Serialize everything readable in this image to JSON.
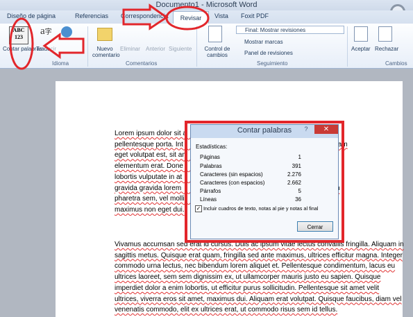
{
  "window": {
    "title": "Documento1 - Microsoft Word"
  },
  "tabs": [
    "Diseño de página",
    "Referencias",
    "Correspondencia",
    "Revisar",
    "Vista",
    "Foxit PDF"
  ],
  "ribbon": {
    "contar_palabras": "Contar palabras",
    "abc_icon_text": "ABC\n123",
    "traducir": "Traducir",
    "idioma": "Idioma",
    "nuevo_comentario": "Nuevo comentario",
    "eliminar": "Eliminar",
    "anterior": "Anterior",
    "siguiente": "Siguiente",
    "control_cambios": "Control de cambios",
    "final_mostrar": "Final: Mostrar revisiones",
    "mostrar_marcas": "Mostrar marcas",
    "panel_revisiones": "Panel de revisiones",
    "aceptar": "Aceptar",
    "rechazar": "Rechazar",
    "groups": {
      "idioma": "Idioma",
      "comentarios": "Comentarios",
      "seguimiento": "Seguimiento",
      "cambios": "Cambios"
    }
  },
  "document": {
    "paragraph1": [
      "Lorem ipsum dolor sit a                                                      risus id mauris",
      "pellentesque porta. Int                                                      r commodo. Nullam",
      "eget volutpat est, sit am                                                     e purus a,",
      "elementum erat. Done                                                       risus vitae est",
      "lobortis vulputate in at                                                      is euismod velit,",
      "gravida gravida lorem                                                        are, quam quam",
      "pharetra sem, vel molli                                                       nim malesuada",
      "maximus non eget dui."
    ],
    "paragraph2": [
      "Vivamus accumsan sed erat id cursus. Duis ac ipsum vitae lectus convallis fringilla. Aliquam in",
      "sagittis metus. Quisque erat quam, fringilla sed ante maximus, ultrices efficitur magna. Integer",
      "commodo urna lectus, nec bibendum lorem aliquet et. Pellentesque condimentum, lacus eu",
      "ultrices laoreet, sem sem dignissim ex, ut ullamcorper mauris justo eu sapien. Quisque",
      "imperdiet dolor a enim lobortis, ut efficitur purus sollicitudin. Pellentesque sit amet velit",
      "ultrices, viverra eros sit amet, maximus dui. Aliquam erat volutpat. Quisque faucibus, diam vel",
      "venenatis commodo, elit ex ultrices erat, ut commodo risus sem id tellus."
    ]
  },
  "dialog": {
    "title": "Contar palabras",
    "help": "?",
    "close": "✕",
    "stats_heading": "Estadísticas:",
    "stats": [
      {
        "label": "Páginas",
        "value": "1"
      },
      {
        "label": "Palabras",
        "value": "391"
      },
      {
        "label": "Caracteres (sin espacios)",
        "value": "2.276"
      },
      {
        "label": "Caracteres (con espacios)",
        "value": "2.662"
      },
      {
        "label": "Párrafos",
        "value": "5"
      },
      {
        "label": "Líneas",
        "value": "36"
      }
    ],
    "checkbox_label": "Incluir cuadros de texto, notas al pie y notas al final",
    "checkbox_checked": "✓",
    "close_button": "Cerrar"
  },
  "colors": {
    "annotation_red": "#e2262b",
    "ribbon_text": "#1e395b"
  }
}
